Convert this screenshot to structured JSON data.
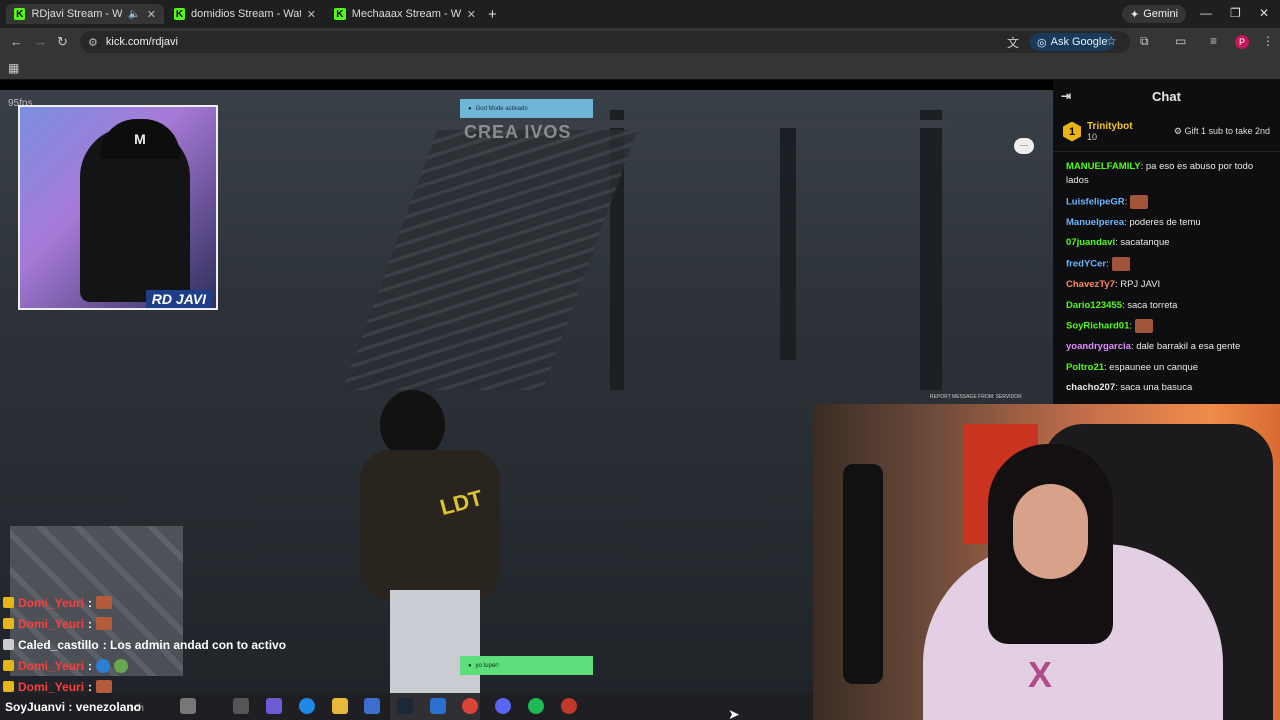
{
  "browser": {
    "tabs": [
      {
        "title": "RDjavi Stream - Watch Live",
        "active": true
      },
      {
        "title": "domidios Stream - Watch Live o",
        "active": false
      },
      {
        "title": "Mechaaax Stream - Watch Live",
        "active": false
      }
    ],
    "new_tab_label": "+",
    "gemini_label": "Gemini",
    "url": "kick.com/rdjavi",
    "ask_google_label": "Ask Google",
    "profile_initial": "P"
  },
  "game": {
    "fps_label": "95fps",
    "top_notification": "God Mode activado",
    "watermark": "CREA IVOS",
    "bottom_notification": "yo tuper!",
    "report_text": "REPORT MESSAGE FROM: SERVIDOR",
    "streamer_tag": "RD JAVI",
    "cap_logo": "M",
    "jacket_logo": "LDT",
    "hoodie_mark": "X",
    "overlay_chat": [
      {
        "user": "Domi_Yeuri",
        "text": ":"
      },
      {
        "user": "Domi_Yeuri",
        "text": ":"
      },
      {
        "user": "Caled_castillo",
        "text": ": Los admin andad con to activo"
      },
      {
        "user": "Domi_Yeuri",
        "text": ":"
      },
      {
        "user": "Domi_Yeuri",
        "text": ":"
      }
    ],
    "bottom_caption": "SoyJuanvi : venezolano",
    "taskbar_search": "rch"
  },
  "chat": {
    "title": "Chat",
    "pinned": {
      "rank": "1",
      "user": "Trinitybot",
      "count": "10",
      "action": "Gift 1 sub to take 2nd"
    },
    "messages": [
      {
        "user": "MANUELFAMILY",
        "color": "#53fc18",
        "text": ": pa eso es abuso por todo lados",
        "emote": false
      },
      {
        "user": "LuisfelipeGR",
        "color": "#6cb4ff",
        "text": ":",
        "emote": true
      },
      {
        "user": "Manuelperea",
        "color": "#6cb4ff",
        "text": ": poderes de temu",
        "emote": false
      },
      {
        "user": "07juandavi",
        "color": "#53fc18",
        "text": ": sacatanque",
        "emote": false
      },
      {
        "user": "fredYCer",
        "color": "#6cb4ff",
        "text": ":",
        "emote": true
      },
      {
        "user": "ChavezTy7",
        "color": "#ff8a65",
        "text": ": RPJ JAVI",
        "emote": false
      },
      {
        "user": "Dario123455",
        "color": "#53fc18",
        "text": ": saca torreta",
        "emote": false
      },
      {
        "user": "SoyRichard01",
        "color": "#53fc18",
        "text": ":",
        "emote": true
      },
      {
        "user": "yoandrygarcia",
        "color": "#e28cff",
        "text": ": dale barrakil a esa gente",
        "emote": false
      },
      {
        "user": "Poltro21",
        "color": "#53fc18",
        "text": ": espaunee un canque",
        "emote": false
      },
      {
        "user": "chacho207",
        "color": "#e9e9ea",
        "text": ": saca una basuca",
        "emote": false
      }
    ]
  }
}
